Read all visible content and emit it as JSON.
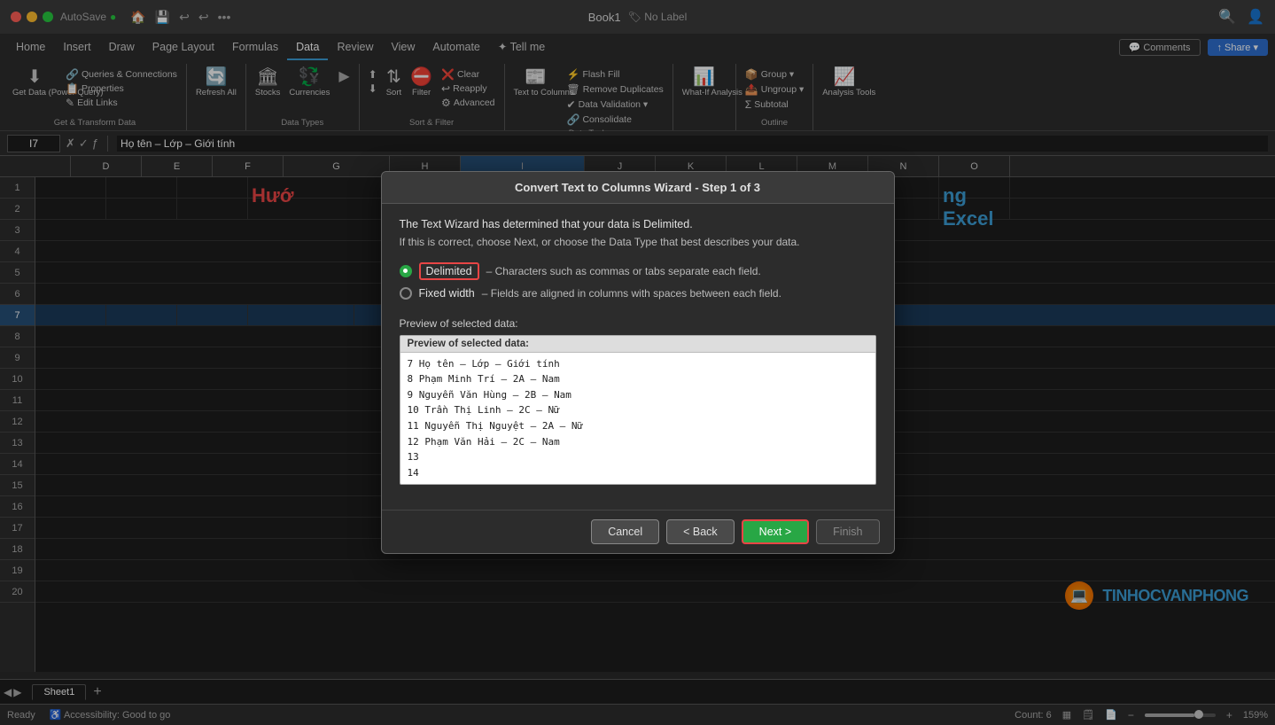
{
  "titleBar": {
    "autosave": "AutoSave",
    "autosave_state": "●",
    "title": "Book1",
    "no_label": "🏷 No Label",
    "icons": [
      "⬅",
      "🏠",
      "💾",
      "🔄",
      "↩",
      "↪",
      "•••"
    ]
  },
  "tabs": {
    "items": [
      "Home",
      "Insert",
      "Draw",
      "Page Layout",
      "Formulas",
      "Data",
      "Review",
      "View",
      "Automate",
      "✦ Tell me"
    ]
  },
  "ribbon": {
    "active_tab": "Data",
    "groups": [
      {
        "label": "Get & Transform Data",
        "items": [
          {
            "icon": "⬇",
            "label": "Get Data (Power Query)"
          },
          {
            "icon": "📊",
            "label": "Queries & Connections"
          },
          {
            "icon": "📋",
            "label": "Properties"
          },
          {
            "icon": "✎",
            "label": "Edit Links"
          }
        ]
      },
      {
        "label": "",
        "items": [
          {
            "icon": "🔄",
            "label": "Refresh All"
          }
        ]
      },
      {
        "label": "Data Types",
        "items": [
          {
            "icon": "🏛",
            "label": "Stocks"
          },
          {
            "icon": "💱",
            "label": "Currencies"
          },
          {
            "icon": "▶",
            "label": ""
          }
        ]
      },
      {
        "label": "Sort & Filter",
        "items": [
          {
            "icon": "⬆⬇",
            "label": "Sort"
          },
          {
            "icon": "⛔",
            "label": "Filter"
          },
          {
            "icon": "❎",
            "label": "Clear"
          },
          {
            "icon": "↩",
            "label": "Reapply"
          },
          {
            "icon": "⚙",
            "label": "Advanced"
          }
        ]
      },
      {
        "label": "Data Tools",
        "items": [
          {
            "icon": "📋",
            "label": "Text to Columns"
          },
          {
            "icon": "⚡",
            "label": "Flash Fill"
          },
          {
            "icon": "❌",
            "label": "Remove Duplicates"
          },
          {
            "icon": "✔",
            "label": "Data Validation"
          },
          {
            "icon": "🔗",
            "label": "Consolidate"
          }
        ]
      },
      {
        "label": "",
        "items": [
          {
            "icon": "📊",
            "label": "What-If Analysis"
          }
        ]
      },
      {
        "label": "Outline",
        "items": [
          {
            "icon": "📦",
            "label": "Group"
          },
          {
            "icon": "📤",
            "label": "Ungroup"
          },
          {
            "icon": "📋",
            "label": "Subtotal"
          }
        ]
      },
      {
        "label": "",
        "items": [
          {
            "icon": "📈",
            "label": "Analysis Tools"
          }
        ]
      }
    ]
  },
  "formulaBar": {
    "cell_ref": "I7",
    "formula": "Họ tên – Lớp – Giới tính"
  },
  "columns": [
    "D",
    "E",
    "F",
    "G",
    "H",
    "I",
    "J",
    "K",
    "L",
    "M",
    "N",
    "O"
  ],
  "rows": [
    1,
    2,
    3,
    4,
    5,
    6,
    7,
    8,
    9,
    10,
    11,
    12,
    13,
    14,
    15,
    16,
    17,
    18,
    19,
    20
  ],
  "spreadsheet": {
    "title_left": "Hướ",
    "title_right": "ng Excel",
    "title_full": "Hướng dẫn chia cột trong Excel"
  },
  "dialog": {
    "title": "Convert Text to Columns Wizard - Step 1 of 3",
    "intro": "The Text Wizard has determined that your data is Delimited.",
    "sub": "If this is correct, choose Next, or choose the Data Type that best describes your data.",
    "options": [
      {
        "label": "Delimited",
        "desc": "– Characters such as commas or tabs separate each field.",
        "selected": true
      },
      {
        "label": "Fixed width",
        "desc": "– Fields are aligned in columns with spaces between each field.",
        "selected": false
      }
    ],
    "preview_label": "Preview of selected data:",
    "preview_header": "Preview of selected data:",
    "preview_data": [
      "7  Họ tên – Lớp – Giới tính",
      "8  Phạm Minh Trí – 2A – Nam",
      "9  Nguyễn Văn Hùng – 2B – Nam",
      "10 Trần Thị Linh – 2C – Nữ",
      "11 Nguyễn Thị Nguyệt – 2A – Nữ",
      "12 Phạm Văn Hải – 2C – Nam",
      "13",
      "14"
    ],
    "buttons": {
      "cancel": "Cancel",
      "back": "< Back",
      "next": "Next >",
      "finish": "Finish"
    }
  },
  "statusBar": {
    "ready": "Ready",
    "accessibility": "♿ Accessibility: Good to go",
    "count": "Count: 6",
    "zoom": "159%"
  },
  "sheetTabs": {
    "tabs": [
      "Sheet1"
    ],
    "active": "Sheet1"
  },
  "actionButtons": {
    "comments": "💬 Comments",
    "share": "↑ Share ▾"
  }
}
